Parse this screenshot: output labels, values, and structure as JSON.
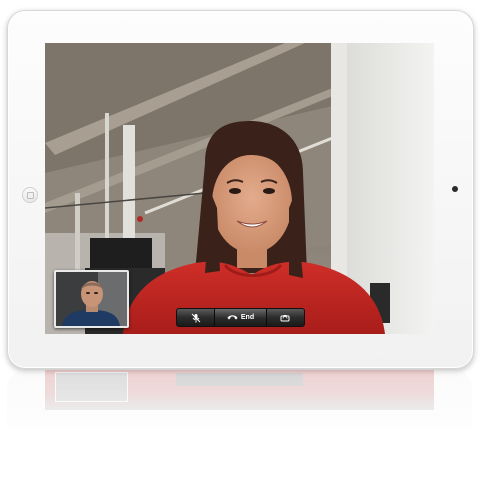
{
  "call_controls": {
    "mute_icon": "microphone-mute-icon",
    "end_label": "End",
    "end_icon": "phone-handset-icon",
    "switch_icon": "camera-switch-icon"
  },
  "colors": {
    "end_bar": "#2c2c2c",
    "shirt_red": "#c42a24",
    "bezel": "#f5f5f5"
  }
}
